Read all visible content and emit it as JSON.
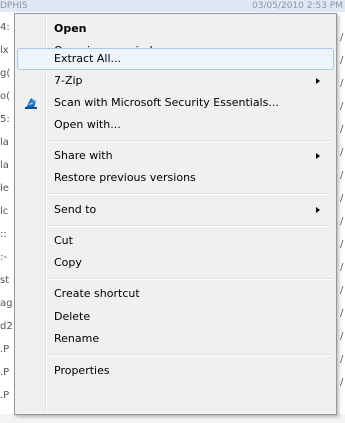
{
  "background": {
    "header_left": "DPHIS",
    "header_right": "03/05/2010 2:53 PM",
    "row_fragments": [
      "4:",
      "lx",
      "g(",
      "o(",
      "5:",
      "la",
      "la",
      "le",
      "lc",
      "::",
      ":-",
      "st",
      "ag",
      "d2",
      ".P",
      ".P",
      ".P"
    ],
    "right_fragments": [
      "/",
      "/",
      "/",
      "/",
      "/",
      "/",
      "/",
      "/",
      "/",
      "/",
      "/",
      "/",
      "/",
      "/",
      "/",
      "/"
    ]
  },
  "menu": {
    "open": "Open",
    "open_new_window": "Open in new window",
    "extract_all": "Extract All...",
    "seven_zip": "7-Zip",
    "scan_mse": "Scan with Microsoft Security Essentials...",
    "open_with": "Open with...",
    "share_with": "Share with",
    "restore_previous": "Restore previous versions",
    "send_to": "Send to",
    "cut": "Cut",
    "copy": "Copy",
    "create_shortcut": "Create shortcut",
    "delete": "Delete",
    "rename": "Rename",
    "properties": "Properties"
  },
  "icons": {
    "mse_icon": "microsoft-security-essentials-icon",
    "submenu_arrow": "chevron-right-icon"
  },
  "colors": {
    "menu_bg": "#f0f0f0",
    "highlight_bg": "#eef4fc",
    "highlight_border": "#a8c8f0",
    "mse_blue": "#1a6fc4"
  }
}
